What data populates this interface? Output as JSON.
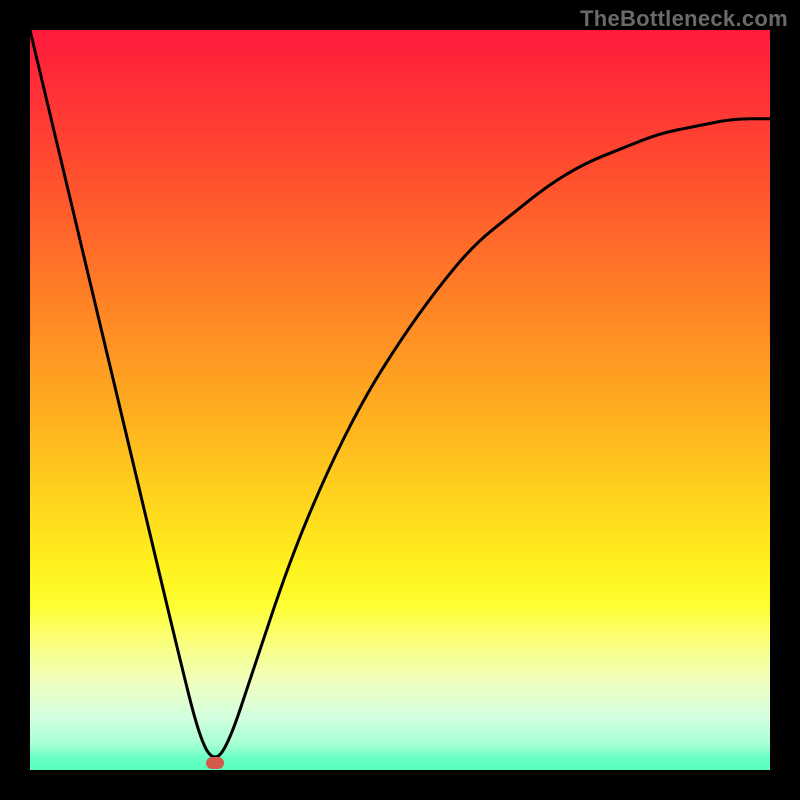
{
  "attribution": "TheBottleneck.com",
  "colors": {
    "frame_bg": "#000000",
    "marker": "#d35a4a",
    "curve": "#000000",
    "gradient": [
      "#ff1a3c",
      "#ff7d26",
      "#ffff30",
      "#00ff9c"
    ]
  },
  "chart_data": {
    "type": "line",
    "title": "",
    "xlabel": "",
    "ylabel": "",
    "xlim": [
      0,
      100
    ],
    "ylim": [
      0,
      100
    ],
    "grid": false,
    "legend": false,
    "series": [
      {
        "name": "bottleneck-curve",
        "x": [
          0,
          5,
          10,
          15,
          20,
          23,
          25,
          27,
          30,
          35,
          40,
          45,
          50,
          55,
          60,
          65,
          70,
          75,
          80,
          85,
          90,
          95,
          100
        ],
        "values": [
          100,
          79,
          58,
          37,
          16,
          4,
          1,
          4,
          13,
          28,
          40,
          50,
          58,
          65,
          71,
          75,
          79,
          82,
          84,
          86,
          87,
          88,
          88
        ]
      }
    ],
    "marker": {
      "x": 25,
      "y": 1
    }
  }
}
